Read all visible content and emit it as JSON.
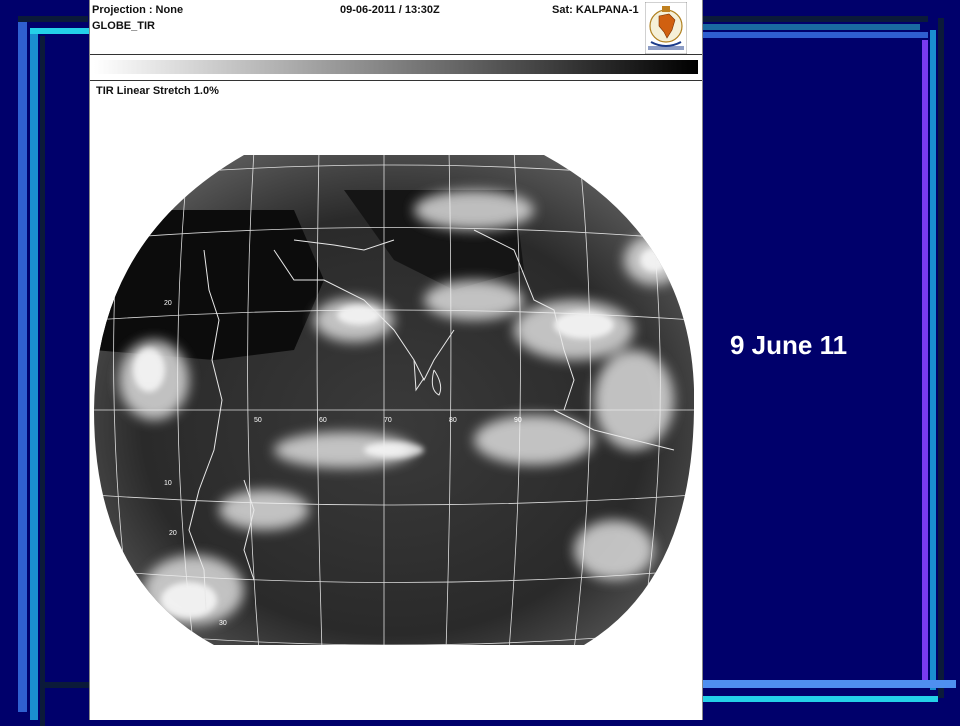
{
  "header": {
    "projection": "Projection : None",
    "product": "GLOBE_TIR",
    "datetime": "09-06-2011 / 13:30Z",
    "satellite": "Sat: KALPANA-1"
  },
  "stretch_label": "TIR Linear Stretch 1.0%",
  "slide_label": "9 June 11",
  "colors": {
    "background": "#00006b",
    "panel": "#ffffff",
    "accent_cyan": "#24d0e8",
    "accent_blue": "#2f5fd0",
    "accent_purple": "#7a3af0"
  },
  "icons": [
    "imd-emblem-icon"
  ],
  "grid_labels": {
    "longitudes": [
      "50",
      "60",
      "70",
      "80",
      "90"
    ],
    "latitudes": [
      "20",
      "10",
      "20",
      "30"
    ]
  }
}
